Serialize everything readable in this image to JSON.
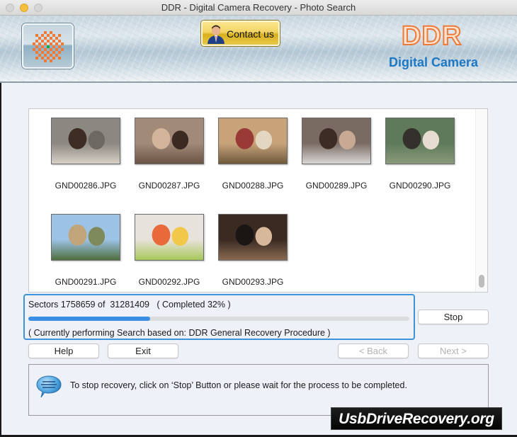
{
  "window": {
    "title": "DDR - Digital Camera Recovery - Photo Search"
  },
  "banner": {
    "logo_icon": "ddr-logo-icon",
    "contact_label": "Contact us",
    "contact_icon": "person-icon",
    "brand_title": "DDR",
    "brand_subtitle": "Digital Camera"
  },
  "thumbnails": [
    {
      "name": "GND00286.JPG",
      "colors": [
        "#8b8781",
        "#6d6862",
        "#3e2d24",
        "#d9d0c8"
      ]
    },
    {
      "name": "GND00287.JPG",
      "colors": [
        "#a28a78",
        "#3a2a22",
        "#d2b49a",
        "#6a5444"
      ]
    },
    {
      "name": "GND00288.JPG",
      "colors": [
        "#c8a37a",
        "#e4d7c2",
        "#9a3a36",
        "#6f5a3c"
      ]
    },
    {
      "name": "GND00289.JPG",
      "colors": [
        "#7a6b62",
        "#c8aa94",
        "#3d2c26",
        "#d8d6d6"
      ]
    },
    {
      "name": "GND00290.JPG",
      "colors": [
        "#5e7a5a",
        "#e6dccf",
        "#34302c",
        "#8a9a7a"
      ]
    },
    {
      "name": "GND00291.JPG",
      "colors": [
        "#9cc2e6",
        "#7e8a5c",
        "#c2a47a",
        "#4f6f3e"
      ]
    },
    {
      "name": "GND00292.JPG",
      "colors": [
        "#e8e2dc",
        "#f2c84a",
        "#e86a3a",
        "#a8c85a"
      ]
    },
    {
      "name": "GND00293.JPG",
      "colors": [
        "#3a2a22",
        "#d8b89a",
        "#1a1614",
        "#8a6a52"
      ]
    }
  ],
  "progress": {
    "sectors_text": "Sectors 1758659 of  31281409   ( Completed 32% )",
    "sectors_done": 1758659,
    "sectors_total": 31281409,
    "percent": 32,
    "procedure_text": "( Currently performing Search based on: DDR General Recovery Procedure )"
  },
  "buttons": {
    "stop": "Stop",
    "help": "Help",
    "exit": "Exit",
    "back": "< Back",
    "next": "Next >"
  },
  "info": {
    "icon": "speech-bubble-icon",
    "message": "To stop recovery, click on ‘Stop’ Button or please wait for the process to be completed."
  },
  "watermark": {
    "text": "UsbDriveRecovery.org"
  }
}
